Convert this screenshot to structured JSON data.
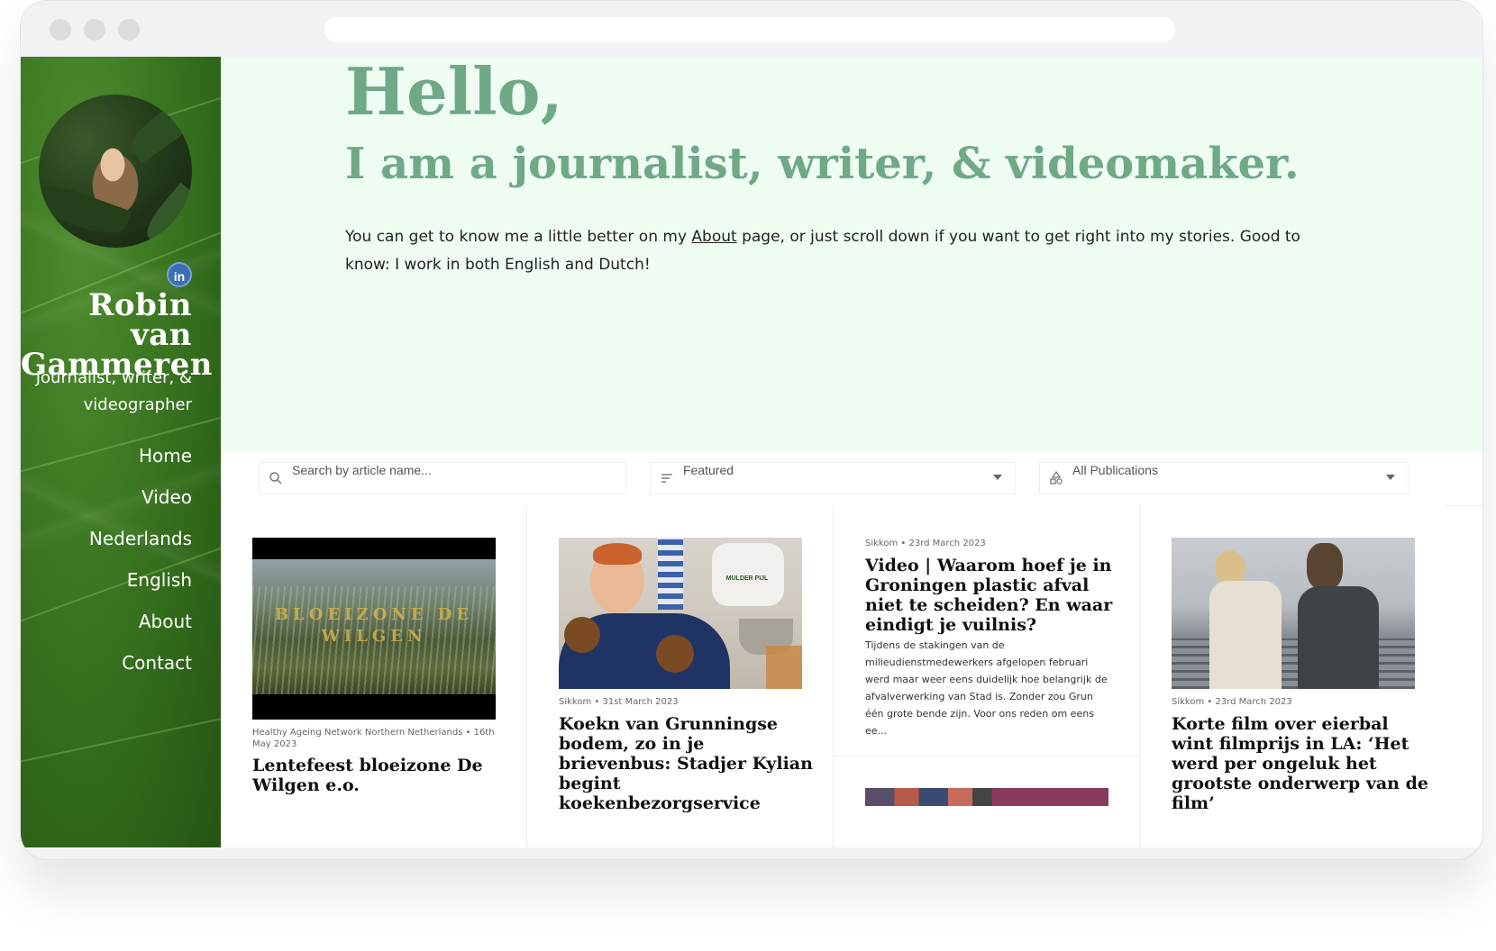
{
  "profile": {
    "name": "Robin van Gammeren",
    "tagline": "Journalist, writer, & videographer",
    "social_label": "in"
  },
  "nav": {
    "items": [
      "Home",
      "Video",
      "Nederlands",
      "English",
      "About",
      "Contact"
    ]
  },
  "hero": {
    "hello": "Hello,",
    "subhead": "I am a journalist, writer, & videomaker.",
    "intro_before": "You can get to know me a little better on my ",
    "intro_link": "About",
    "intro_after": " page, or just scroll down if you want to get right into my stories. Good to know: I work in both English and Dutch!"
  },
  "filters": {
    "search_placeholder": "Search by article name...",
    "sort_value": "Featured",
    "publication_value": "All Publications"
  },
  "articles": [
    {
      "meta": "Healthy Ageing Network Northern Netherlands • 16th May 2023",
      "title": "Lentefeest bloeizone De Wilgen e.o.",
      "thumb_text": "BLOEIZONE DE WILGEN"
    },
    {
      "meta": "Sikkom • 31st March 2023",
      "title": "Koekn van Grunningse bodem, zo in je brievenbus: Stadjer Kylian begint koekenbezorgservice",
      "thumb_text": "MULDER PIJL"
    },
    {
      "meta": "Sikkom • 23rd March 2023",
      "title": "Video | Waarom hoef je in Groningen plastic afval niet te scheiden? En waar eindigt je vuilnis?",
      "excerpt": "Tijdens de stakingen van de milieudienstmedewerkers afgelopen februari werd maar weer eens duidelijk hoe belangrijk de afvalverwerking van Stad is. Zonder zou Grun één grote bende zijn. Voor ons reden om eens ee..."
    },
    {
      "meta": "Sikkom • 23rd March 2023",
      "title": "Korte film over eierbal wint filmprijs in LA: ‘Het werd per ongeluk het grootste onderwerp van de film’"
    }
  ],
  "colors": {
    "accent": "#6fa987",
    "hero_bg": "#effcf2",
    "sidebar_green": "#3e7a23"
  }
}
